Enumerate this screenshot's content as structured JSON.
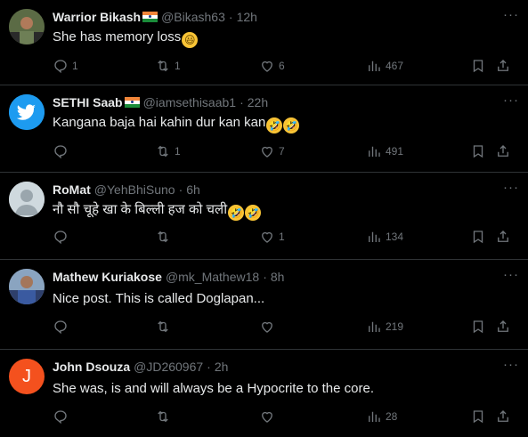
{
  "tweets": [
    {
      "name": "Warrior Bikash",
      "flag": true,
      "handle": "@Bikash63",
      "time": "12h",
      "text": "She has memory loss",
      "emojis": [
        "😃"
      ],
      "replies": "1",
      "retweets": "1",
      "likes": "6",
      "views": "467",
      "avatar": "photo"
    },
    {
      "name": "SETHI Saab",
      "flag": true,
      "handle": "@iamsethisaab1",
      "time": "22h",
      "text": "Kangana baja hai kahin dur kan kan",
      "emojis": [
        "🤣",
        "🤣"
      ],
      "replies": "",
      "retweets": "1",
      "likes": "7",
      "views": "491",
      "avatar": "twitter-bird"
    },
    {
      "name": "RoMat",
      "flag": false,
      "handle": "@YehBhiSuno",
      "time": "6h",
      "text": "नौ सौ चूहे खा के बिल्ली हज को चली",
      "emojis": [
        "🤣",
        "🤣"
      ],
      "replies": "",
      "retweets": "",
      "likes": "1",
      "views": "134",
      "avatar": "default"
    },
    {
      "name": "Mathew Kuriakose",
      "flag": false,
      "handle": "@mk_Mathew18",
      "time": "8h",
      "text": "Nice post. This is called Doglapan...",
      "emojis": [],
      "replies": "",
      "retweets": "",
      "likes": "",
      "views": "219",
      "avatar": "photo2"
    },
    {
      "name": "John Dsouza",
      "flag": false,
      "handle": "@JD260967",
      "time": "2h",
      "text": "She was, is and will always be a Hypocrite to the core.",
      "emojis": [],
      "replies": "",
      "retweets": "",
      "likes": "",
      "views": "28",
      "avatar": "letter",
      "avatar_letter": "J"
    }
  ],
  "separator_dot": "·",
  "more_glyph": "···",
  "colors": {
    "background": "#000000",
    "text": "#e7e9ea",
    "muted": "#71767b",
    "divider": "#2f3336"
  }
}
